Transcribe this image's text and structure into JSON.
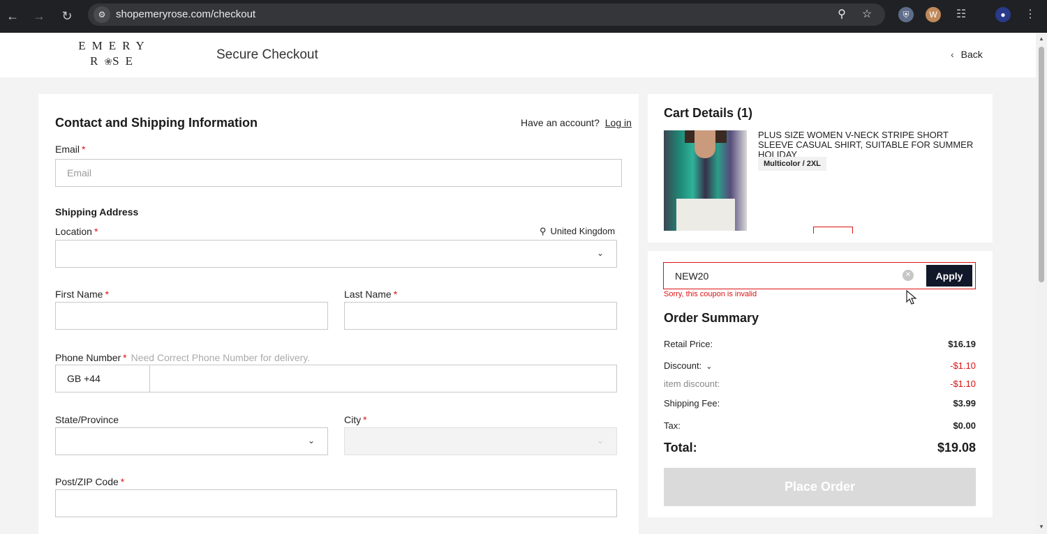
{
  "browser": {
    "url": "shopemeryrose.com/checkout"
  },
  "header": {
    "logo_line1": "EMERY",
    "logo_line2_a": "R",
    "logo_line2_b": "SE",
    "title": "Secure Checkout",
    "back_label": "Back"
  },
  "contact": {
    "title": "Contact and Shipping Information",
    "account_prompt": "Have an account?",
    "login_label": "Log in",
    "email_label": "Email",
    "email_placeholder": "Email"
  },
  "shipping": {
    "title": "Shipping Address",
    "location_label": "Location",
    "location_hint": "United Kingdom",
    "first_name_label": "First Name",
    "last_name_label": "Last Name",
    "phone_label": "Phone Number",
    "phone_hint": "Need Correct Phone Number for delivery.",
    "phone_prefix": "GB +44",
    "state_label": "State/Province",
    "city_label": "City",
    "postcode_label": "Post/ZIP Code"
  },
  "cart": {
    "title": "Cart Details (1)",
    "item_title": "PLUS SIZE WOMEN V-NECK STRIPE SHORT SLEEVE CASUAL SHIRT, SUITABLE FOR SUMMER HOLIDAY",
    "item_variant": "Multicolor / 2XL"
  },
  "summary": {
    "coupon_value": "NEW20",
    "apply_label": "Apply",
    "coupon_error": "Sorry, this coupon is invalid",
    "title": "Order Summary",
    "retail_label": "Retail Price:",
    "retail_value": "$16.19",
    "discount_label": "Discount:",
    "discount_value": "-$1.10",
    "item_discount_label": "item discount:",
    "item_discount_value": "-$1.10",
    "shipping_label": "Shipping Fee:",
    "shipping_value": "$3.99",
    "tax_label": "Tax:",
    "tax_value": "$0.00",
    "total_label": "Total:",
    "total_value": "$19.08",
    "place_order_label": "Place Order"
  },
  "colors": {
    "accent_red": "#d11111",
    "apply_button": "#10182a",
    "chrome_bg": "#202124"
  }
}
